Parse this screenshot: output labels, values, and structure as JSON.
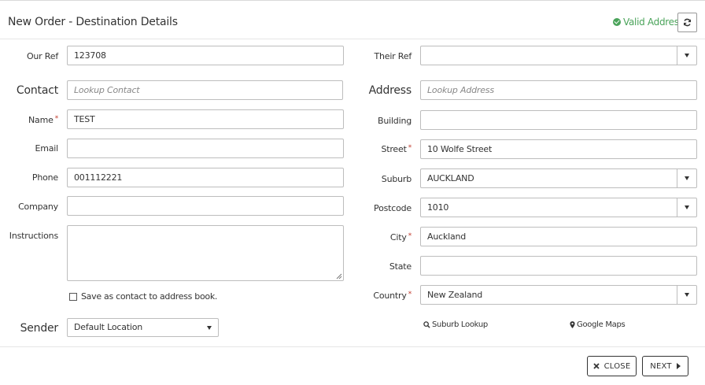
{
  "header": {
    "title": "New Order - Destination Details",
    "valid_status": "Valid Address",
    "valid_color": "#4aa35a",
    "refresh_icon": "refresh-icon"
  },
  "left": {
    "our_ref": {
      "label": "Our Ref",
      "value": "123708"
    },
    "contact": {
      "label": "Contact",
      "placeholder": "Lookup Contact"
    },
    "name": {
      "label": "Name",
      "required_mark": "*",
      "value": "TEST"
    },
    "email": {
      "label": "Email",
      "value": ""
    },
    "phone": {
      "label": "Phone",
      "value": "001112221"
    },
    "company": {
      "label": "Company",
      "value": ""
    },
    "instructions": {
      "label": "Instructions",
      "value": ""
    },
    "save_contact_label": "Save as contact to address book.",
    "sender": {
      "label": "Sender",
      "value": "Default Location"
    }
  },
  "right": {
    "their_ref": {
      "label": "Their Ref",
      "value": ""
    },
    "address": {
      "label": "Address",
      "placeholder": "Lookup Address"
    },
    "building": {
      "label": "Building",
      "value": ""
    },
    "street": {
      "label": "Street",
      "required_mark": "*",
      "value": "10 Wolfe Street"
    },
    "suburb": {
      "label": "Suburb",
      "value": "AUCKLAND"
    },
    "postcode": {
      "label": "Postcode",
      "value": "1010"
    },
    "city": {
      "label": "City",
      "required_mark": "*",
      "value": "Auckland"
    },
    "state": {
      "label": "State",
      "value": ""
    },
    "country": {
      "label": "Country",
      "required_mark": "*",
      "value": "New Zealand"
    },
    "suburb_lookup_label": "Suburb Lookup",
    "google_maps_label": "Google Maps"
  },
  "footer": {
    "close_label": "CLOSE",
    "next_label": "NEXT"
  }
}
